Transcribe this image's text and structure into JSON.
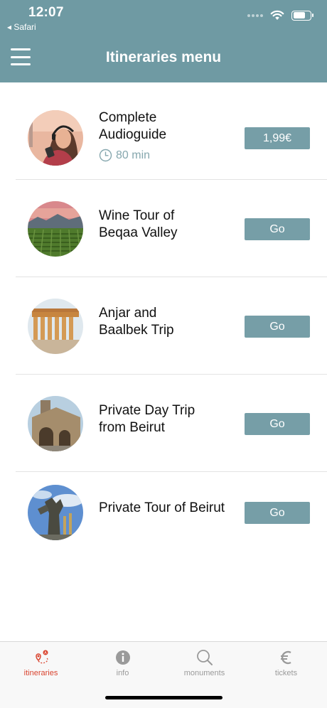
{
  "status_bar": {
    "time": "12:07",
    "back_label": "◂ Safari"
  },
  "nav": {
    "title": "Itineraries menu"
  },
  "items": [
    {
      "title_line1": "Complete",
      "title_line2": "Audioguide",
      "duration": "80 min",
      "action": "1,99€",
      "thumb": "woman-listening-audioguide"
    },
    {
      "title_line1": "Wine Tour of",
      "title_line2": "Beqaa Valley",
      "action": "Go",
      "thumb": "vineyard-valley"
    },
    {
      "title_line1": "Anjar and",
      "title_line2": "Baalbek Trip",
      "action": "Go",
      "thumb": "roman-temple-columns"
    },
    {
      "title_line1": "Private Day Trip",
      "title_line2": "from Beirut",
      "action": "Go",
      "thumb": "stone-church"
    },
    {
      "title_line1": "Private Tour of Beirut",
      "action": "Go",
      "thumb": "martyrs-statue"
    }
  ],
  "tabs": [
    {
      "label": "itineraries",
      "icon": "route-pin-icon",
      "active": true
    },
    {
      "label": "info",
      "icon": "info-icon",
      "active": false
    },
    {
      "label": "monuments",
      "icon": "search-icon",
      "active": false
    },
    {
      "label": "tickets",
      "icon": "euro-icon",
      "active": false
    }
  ],
  "colors": {
    "header": "#6f9aa3",
    "button": "#769ea7",
    "active_tab": "#d9442f",
    "inactive_tab": "#9a9a9a"
  }
}
